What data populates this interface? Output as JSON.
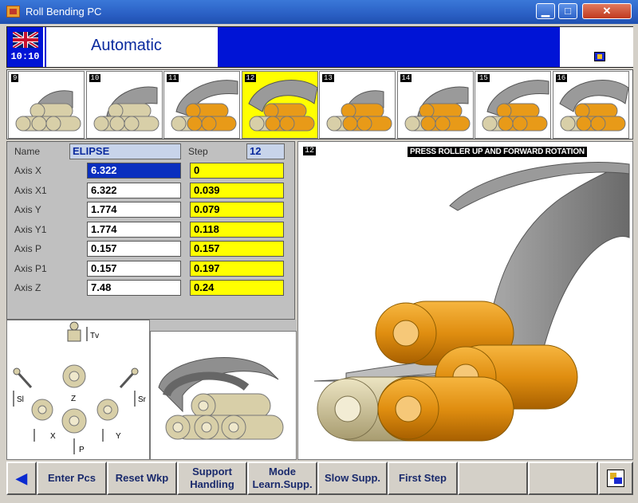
{
  "window": {
    "title": "Roll Bending PC",
    "minimize": "▁",
    "maximize": "□",
    "close": "✕"
  },
  "header": {
    "time": "10:10",
    "mode": "Automatic"
  },
  "steps": [
    {
      "num": "9",
      "active": false
    },
    {
      "num": "10",
      "active": false
    },
    {
      "num": "11",
      "active": false
    },
    {
      "num": "12",
      "active": true
    },
    {
      "num": "13",
      "active": false
    },
    {
      "num": "14",
      "active": false
    },
    {
      "num": "15",
      "active": false
    },
    {
      "num": "16",
      "active": false
    }
  ],
  "params": {
    "name_label": "Name",
    "name_value": "ELIPSE",
    "step_label": "Step",
    "step_value": "12",
    "rows": [
      {
        "label": "Axis X",
        "value": "6.322",
        "step": "0"
      },
      {
        "label": "Axis X1",
        "value": "6.322",
        "step": "0.039"
      },
      {
        "label": "Axis Y",
        "value": "1.774",
        "step": "0.079"
      },
      {
        "label": "Axis Y1",
        "value": "1.774",
        "step": "0.118"
      },
      {
        "label": "Axis P",
        "value": "0.157",
        "step": "0.157"
      },
      {
        "label": "Axis P1",
        "value": "0.157",
        "step": "0.197"
      },
      {
        "label": "Axis Z",
        "value": "7.48",
        "step": "0.24"
      }
    ]
  },
  "schematic": {
    "tv": "Tv",
    "sl": "Sl",
    "sr": "Sr",
    "z": "Z",
    "x": "X",
    "y": "Y",
    "p": "P"
  },
  "view": {
    "step_num": "12",
    "message": "PRESS ROLLER UP AND FORWARD ROTATION"
  },
  "toolbar": {
    "back": "◀",
    "enter_pcs": "Enter Pcs",
    "reset_wkp": "Reset Wkp",
    "support_handling": "Support Handling",
    "mode_learn": "Mode Learn.Supp.",
    "slow_supp": "Slow Supp.",
    "first_step": "First Step"
  },
  "colors": {
    "header_blue": "#0014d6",
    "active_yellow": "#ffff00",
    "roller_orange": "#e89a18",
    "roller_cream": "#d8cfa8"
  }
}
